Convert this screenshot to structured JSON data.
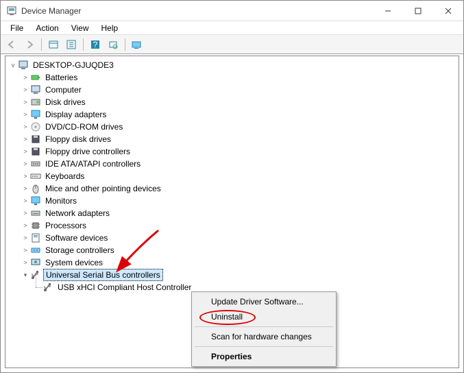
{
  "window": {
    "title": "Device Manager"
  },
  "menu": {
    "file": "File",
    "action": "Action",
    "view": "View",
    "help": "Help"
  },
  "root": {
    "name": "DESKTOP-GJUQDE3"
  },
  "categories": [
    "Batteries",
    "Computer",
    "Disk drives",
    "Display adapters",
    "DVD/CD-ROM drives",
    "Floppy disk drives",
    "Floppy drive controllers",
    "IDE ATA/ATAPI controllers",
    "Keyboards",
    "Mice and other pointing devices",
    "Monitors",
    "Network adapters",
    "Processors",
    "Software devices",
    "Storage controllers",
    "System devices",
    "Universal Serial Bus controllers"
  ],
  "usb_child": "USB xHCI Compliant Host Controller",
  "context_menu": {
    "update": "Update Driver Software...",
    "uninstall": "Uninstall",
    "scan": "Scan for hardware changes",
    "properties": "Properties"
  }
}
